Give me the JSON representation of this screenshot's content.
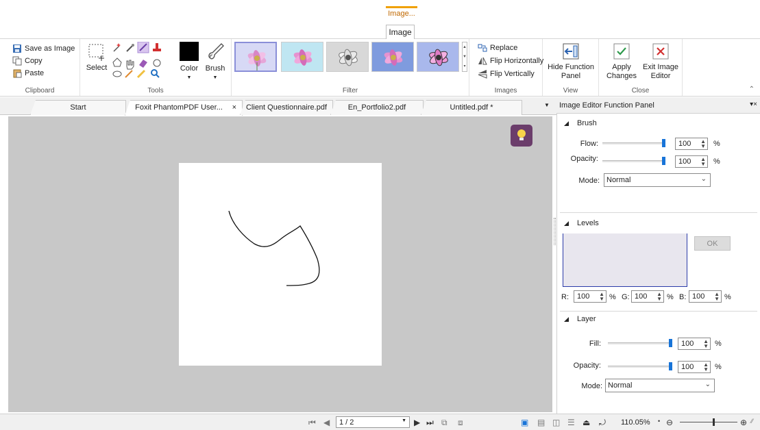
{
  "context_tab": {
    "group_title": "Image...",
    "tab": "Image"
  },
  "ribbon": {
    "clipboard": {
      "save_as_image": "Save as Image",
      "copy": "Copy",
      "paste": "Paste",
      "label": "Clipboard"
    },
    "tools": {
      "select": "Select",
      "color": "Color",
      "brush": "Brush",
      "label": "Tools"
    },
    "filter": {
      "label": "Filter"
    },
    "images": {
      "replace": "Replace",
      "flip_h": "Flip Horizontally",
      "flip_v": "Flip Vertically",
      "label": "Images"
    },
    "view": {
      "hide_line1": "Hide Function",
      "hide_line2": "Panel",
      "label": "View"
    },
    "close": {
      "apply_line1": "Apply",
      "apply_line2": "Changes",
      "exit_line1": "Exit Image",
      "exit_line2": "Editor",
      "label": "Close"
    }
  },
  "doc_tabs": [
    "Start",
    "Foxit PhantomPDF User...",
    "Client Questionnaire.pdf",
    "En_Portfolio2.pdf",
    "Untitled.pdf *"
  ],
  "doc_tab_close": "×",
  "panel": {
    "title": "Image Editor Function Panel",
    "brush": {
      "title": "Brush",
      "flow_label": "Flow:",
      "flow_value": "100",
      "flow_level": 100,
      "opacity_label": "Opacity:",
      "opacity_value": "100",
      "opacity_level": 100,
      "mode_label": "Mode:",
      "mode_value": "Normal",
      "unit": "%"
    },
    "levels": {
      "title": "Levels",
      "ok": "OK",
      "r_label": "R:",
      "r_value": "100",
      "g_label": "G:",
      "g_value": "100",
      "b_label": "B:",
      "b_value": "100",
      "unit": "%"
    },
    "layer": {
      "title": "Layer",
      "fill_label": "Fill:",
      "fill_value": "100",
      "fill_level": 100,
      "opacity_label": "Opacity:",
      "opacity_value": "100",
      "opacity_level": 100,
      "mode_label": "Mode:",
      "mode_value": "Normal",
      "unit": "%"
    }
  },
  "status": {
    "page": "1 / 2",
    "zoom": "110.05%"
  },
  "colors": {
    "accent": "#1874d8",
    "bulb": "#6b3d6b",
    "apply": "#2e9a4c",
    "exit": "#d23030",
    "context": "#f0a000"
  }
}
